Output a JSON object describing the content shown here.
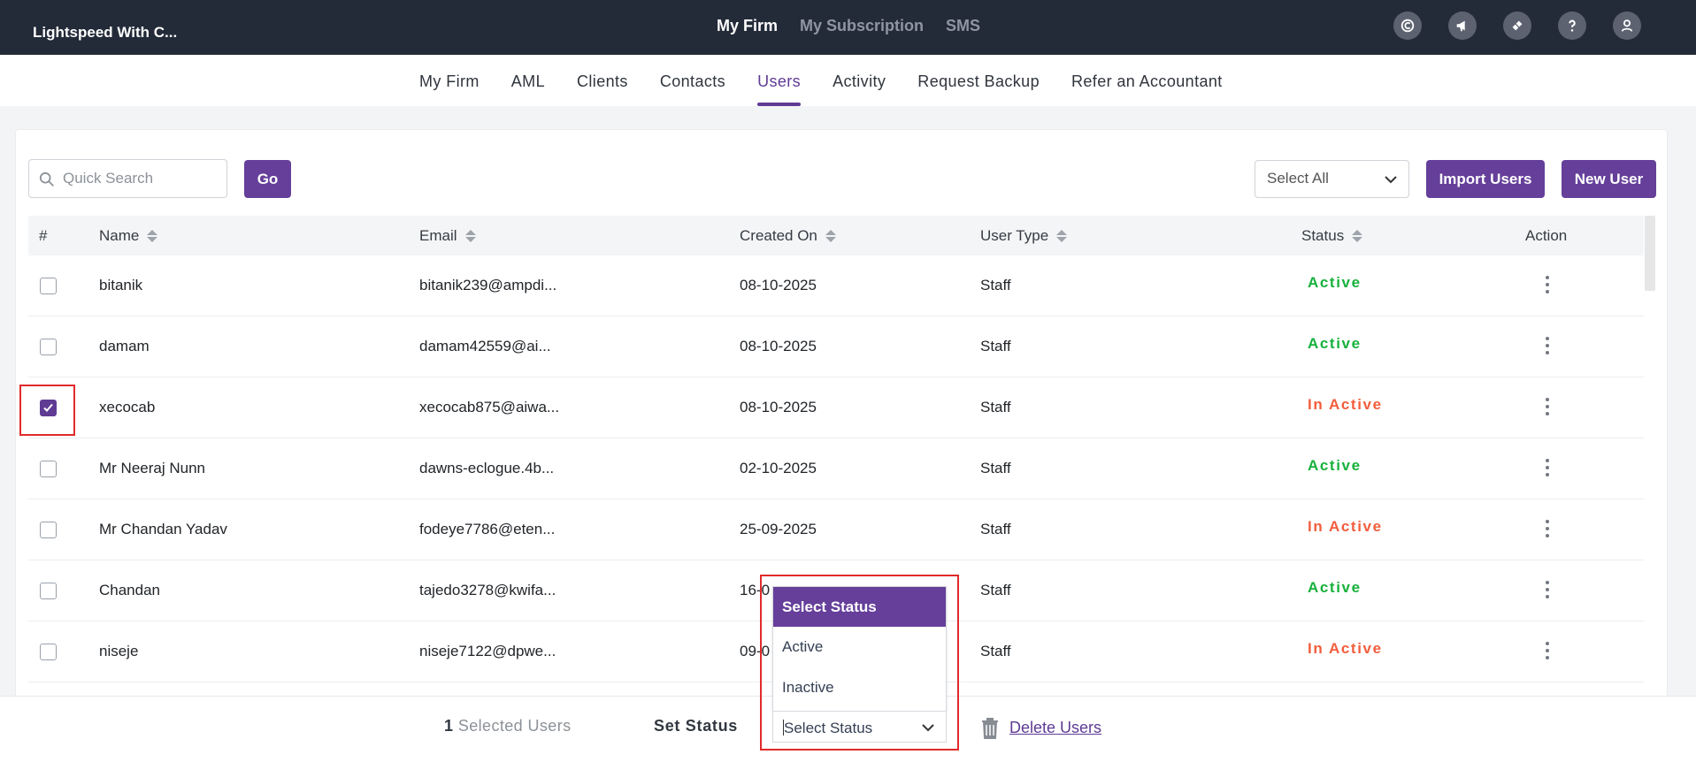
{
  "header": {
    "brand": "Lightspeed With C...",
    "nav": [
      {
        "label": "My Firm"
      },
      {
        "label": "My Subscription"
      },
      {
        "label": "SMS"
      }
    ]
  },
  "tabs": [
    {
      "label": "My Firm"
    },
    {
      "label": "AML"
    },
    {
      "label": "Clients"
    },
    {
      "label": "Contacts"
    },
    {
      "label": "Users"
    },
    {
      "label": "Activity"
    },
    {
      "label": "Request Backup"
    },
    {
      "label": "Refer an Accountant"
    }
  ],
  "toolbar": {
    "search_placeholder": "Quick Search",
    "go_label": "Go",
    "select_all_label": "Select All",
    "import_label": "Import Users",
    "new_label": "New User"
  },
  "table": {
    "headers": [
      "#",
      "Name",
      "Email",
      "Created On",
      "User Type",
      "Status",
      "Action"
    ],
    "rows": [
      {
        "checked": false,
        "name": "bitanik",
        "email": "bitanik239@ampdi...",
        "created": "08-10-2025",
        "type": "Staff",
        "status": "Active"
      },
      {
        "checked": false,
        "name": "damam",
        "email": "damam42559@ai...",
        "created": "08-10-2025",
        "type": "Staff",
        "status": "Active"
      },
      {
        "checked": true,
        "name": "xecocab",
        "email": "xecocab875@aiwa...",
        "created": "08-10-2025",
        "type": "Staff",
        "status": "In Active"
      },
      {
        "checked": false,
        "name": "Mr Neeraj Nunn",
        "email": "dawns-eclogue.4b...",
        "created": "02-10-2025",
        "type": "Staff",
        "status": "Active"
      },
      {
        "checked": false,
        "name": "Mr Chandan Yadav",
        "email": "fodeye7786@eten...",
        "created": "25-09-2025",
        "type": "Staff",
        "status": "In Active"
      },
      {
        "checked": false,
        "name": "Chandan",
        "email": "tajedo3278@kwifa...",
        "created": "16-0",
        "type": "Staff",
        "status": "Active"
      },
      {
        "checked": false,
        "name": "niseje",
        "email": "niseje7122@dpwe...",
        "created": "09-0",
        "type": "Staff",
        "status": "In Active"
      }
    ],
    "status_colors": {
      "active": "#16b13c",
      "inactive": "#f25d3d"
    }
  },
  "bulk": {
    "count": "1",
    "selected_label": "Selected Users",
    "set_status_label": "Set Status",
    "select_value": "Select Status",
    "options": [
      "Select Status",
      "Active",
      "Inactive"
    ],
    "delete_label": "Delete Users"
  },
  "icons": [
    "search-icon",
    "chevron-down-icon",
    "more-icon",
    "trash-icon",
    "copyright-icon",
    "megaphone-icon",
    "ticket-icon",
    "help-icon",
    "user-icon"
  ],
  "colors": {
    "accent": "#653f9a",
    "topbar": "#232a38"
  }
}
